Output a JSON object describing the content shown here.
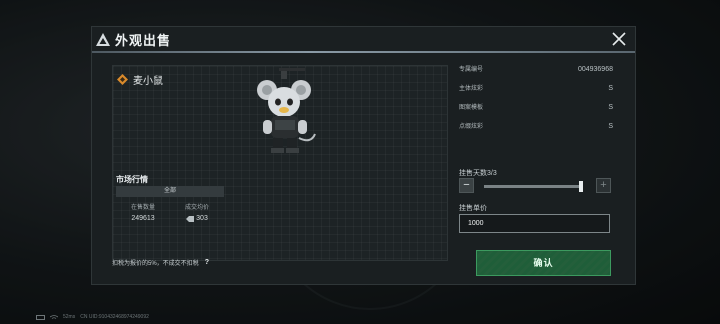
{
  "modal": {
    "title": "外观出售"
  },
  "item": {
    "name": "麦小鼠"
  },
  "market": {
    "title": "市场行情",
    "filter": "全部",
    "columns": [
      {
        "header": "在售数量",
        "value": "249613"
      },
      {
        "header": "成交均价",
        "value": "303"
      }
    ]
  },
  "info": {
    "rows": [
      {
        "label": "专属编号",
        "value": "004936968"
      },
      {
        "label": "主体炫彩",
        "value": "S"
      },
      {
        "label": "图案模板",
        "value": "S"
      },
      {
        "label": "点缀炫彩",
        "value": "S"
      }
    ]
  },
  "sell": {
    "days_label": "挂售天数3/3",
    "days_current": 3,
    "days_max": 3,
    "unit_price_label": "挂售单价",
    "unit_price_value": "1000",
    "minus_symbol": "−",
    "plus_symbol": "+"
  },
  "tax_note": "扣税为报价的5%，不成交不扣税",
  "help_symbol": "?",
  "confirm_label": "确认",
  "status_bar": {
    "ping": "52ms",
    "uid": "CN UID:910432468974249092"
  },
  "colors": {
    "confirm_green": "#1f5e39",
    "confirm_border": "#3c9a5f",
    "rarity_orange": "#d98a2b"
  }
}
